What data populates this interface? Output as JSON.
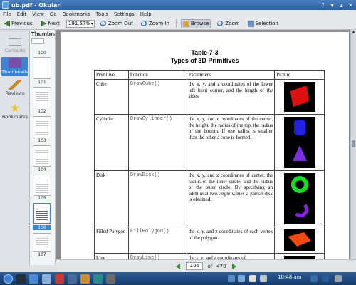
{
  "window": {
    "title": "ub.pdf - Okular"
  },
  "menu": [
    "File",
    "Edit",
    "View",
    "Go",
    "Bookmarks",
    "Tools",
    "Settings",
    "Help"
  ],
  "toolbar": {
    "previous": "Previous",
    "next": "Next",
    "zoom_value": "191.57%",
    "zoom_out": "Zoom Out",
    "zoom_in": "Zoom In",
    "browse": "Browse",
    "zoom": "Zoom",
    "selection": "Selection"
  },
  "sidebar": {
    "contents": "Contents",
    "thumbnails": "Thumbnails",
    "reviews": "Reviews",
    "bookmarks": "Bookmarks",
    "panel_title": "Thumbnails"
  },
  "thumbs": [
    "100",
    "101",
    "102",
    "103",
    "104",
    "105",
    "106",
    "107"
  ],
  "document": {
    "table_number": "Table 7-3",
    "table_title": "Types of 3D Primitives",
    "headers": [
      "Primitive",
      "Function",
      "Parameters",
      "Picture"
    ],
    "rows": [
      {
        "primitive": "Cube",
        "function": "DrawCube()",
        "parameters": "the x, y, and z coordinates of the lower left front corner, and the length of the sides."
      },
      {
        "primitive": "Cylinder",
        "function": "DrawCylinder()",
        "parameters": "the x, y, and z coordinates of the center, the height, the radius of the top, the radius of the bottom. If one radius is smaller than the other a cone is formed."
      },
      {
        "primitive": "Disk",
        "function": "DrawDisk()",
        "parameters": "the x, y, and z coordinates of center, the radius of the inner circle, and the radius of the outer circle. By specifying an additional two angle values a partial disk is obtained."
      },
      {
        "primitive": "Filled Polygon",
        "function": "FillPolygon()",
        "parameters": "the x, y, and z coordinates of each vertex of the polygon."
      },
      {
        "primitive": "Line",
        "function": "DrawLine()",
        "parameters": "the x, y, and z coordinates of"
      }
    ]
  },
  "pagenav": {
    "current": "106",
    "of": "of",
    "total": "470"
  },
  "taskbar": {
    "clock": "10:48 am"
  }
}
